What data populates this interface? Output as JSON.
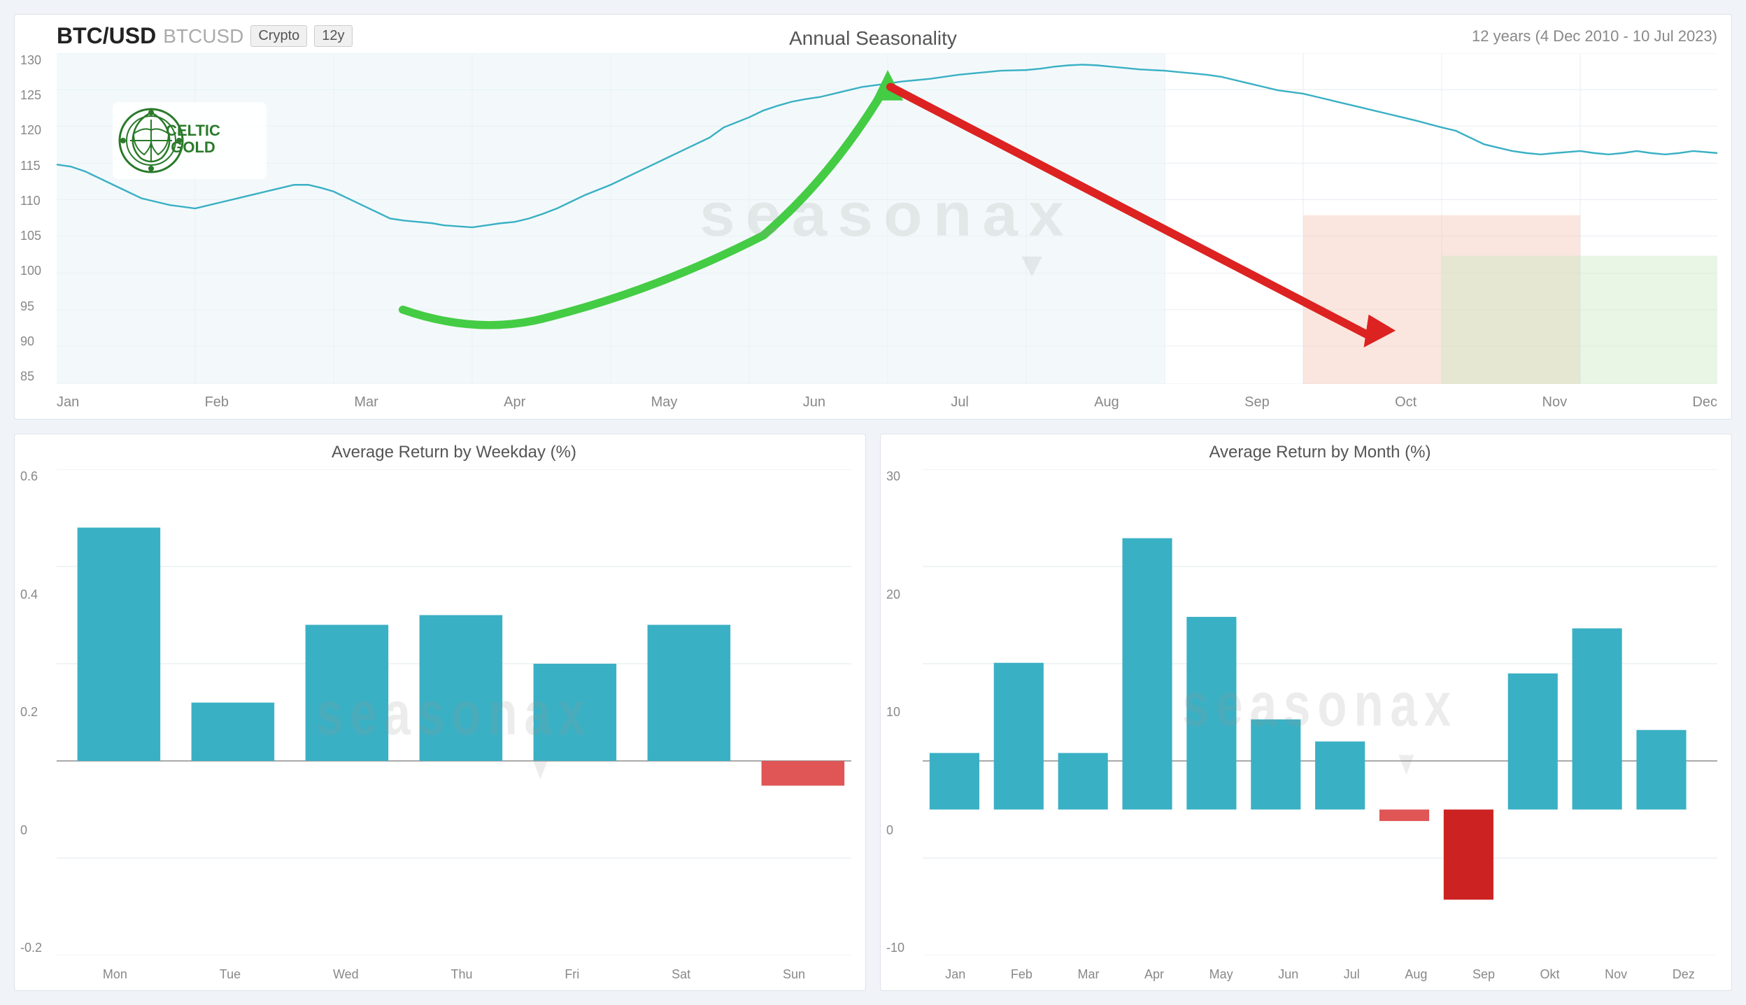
{
  "header": {
    "ticker": "BTC/USD",
    "ticker_code": "BTCUSD",
    "tag_crypto": "Crypto",
    "tag_period": "12y",
    "chart_title": "Annual Seasonality",
    "date_range": "12 years (4 Dec 2010 - 10 Jul 2023)"
  },
  "top_chart": {
    "y_labels": [
      "130",
      "125",
      "120",
      "115",
      "110",
      "105",
      "100",
      "95",
      "90",
      "85"
    ],
    "x_labels": [
      "Jan",
      "Feb",
      "Mar",
      "Apr",
      "May",
      "Jun",
      "Jul",
      "Aug",
      "Sep",
      "Oct",
      "Nov",
      "Dec"
    ]
  },
  "weekday_chart": {
    "title": "Average Return by Weekday (%)",
    "y_labels": [
      "0.6",
      "0.4",
      "0.2",
      "0",
      "-0.2"
    ],
    "x_labels": [
      "Mon",
      "Tue",
      "Wed",
      "Thu",
      "Fri",
      "Sat",
      "Sun"
    ],
    "bars": [
      {
        "label": "Mon",
        "value": 0.48,
        "color": "#3ab0c4"
      },
      {
        "label": "Tue",
        "value": 0.12,
        "color": "#3ab0c4"
      },
      {
        "label": "Wed",
        "value": 0.28,
        "color": "#3ab0c4"
      },
      {
        "label": "Thu",
        "value": 0.3,
        "color": "#3ab0c4"
      },
      {
        "label": "Fri",
        "value": 0.2,
        "color": "#3ab0c4"
      },
      {
        "label": "Sat",
        "value": 0.28,
        "color": "#3ab0c4"
      },
      {
        "label": "Sun",
        "value": -0.05,
        "color": "#e05555"
      }
    ]
  },
  "monthly_chart": {
    "title": "Average Return by Month (%)",
    "y_labels": [
      "30",
      "20",
      "10",
      "0",
      "-10"
    ],
    "x_labels": [
      "Jan",
      "Feb",
      "Mar",
      "Apr",
      "May",
      "Jun",
      "Jul",
      "Aug",
      "Sep",
      "Okt",
      "Nov",
      "Dez"
    ],
    "bars": [
      {
        "label": "Jan",
        "value": 5,
        "color": "#3ab0c4"
      },
      {
        "label": "Feb",
        "value": 13,
        "color": "#3ab0c4"
      },
      {
        "label": "Mar",
        "value": 5,
        "color": "#3ab0c4"
      },
      {
        "label": "Apr",
        "value": 24,
        "color": "#3ab0c4"
      },
      {
        "label": "May",
        "value": 17,
        "color": "#3ab0c4"
      },
      {
        "label": "Jun",
        "value": 8,
        "color": "#3ab0c4"
      },
      {
        "label": "Jul",
        "value": 6,
        "color": "#3ab0c4"
      },
      {
        "label": "Aug",
        "value": -1,
        "color": "#e05555"
      },
      {
        "label": "Sep",
        "value": -8,
        "color": "#cc2222"
      },
      {
        "label": "Okt",
        "value": 12,
        "color": "#3ab0c4"
      },
      {
        "label": "Nov",
        "value": 16,
        "color": "#3ab0c4"
      },
      {
        "label": "Dez",
        "value": 7,
        "color": "#3ab0c4"
      }
    ]
  },
  "watermark": "seasonax",
  "watermark_symbol": "▼"
}
